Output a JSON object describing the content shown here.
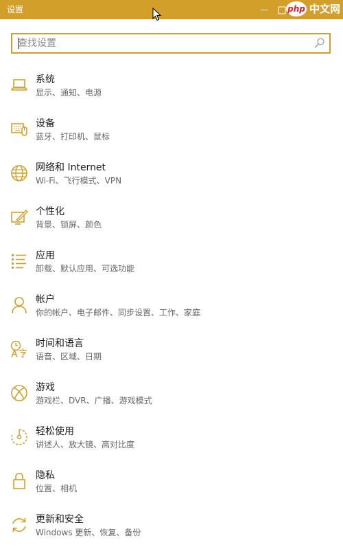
{
  "window": {
    "title": "设置",
    "accent_color": "#d29f2a"
  },
  "watermark": {
    "badge": "php",
    "text": "中文网"
  },
  "search": {
    "placeholder": "查找设置",
    "value": ""
  },
  "items": [
    {
      "title": "系统",
      "desc": "显示、通知、电源",
      "icon": "laptop-icon"
    },
    {
      "title": "设备",
      "desc": "蓝牙、打印机、鼠标",
      "icon": "devices-icon"
    },
    {
      "title": "网络和 Internet",
      "desc": "Wi-Fi、飞行模式、VPN",
      "icon": "globe-icon"
    },
    {
      "title": "个性化",
      "desc": "背景、锁屏、颜色",
      "icon": "personalization-icon"
    },
    {
      "title": "应用",
      "desc": "卸载、默认应用、可选功能",
      "icon": "apps-list-icon"
    },
    {
      "title": "帐户",
      "desc": "你的帐户、电子邮件、同步设置、工作、家庭",
      "icon": "person-icon"
    },
    {
      "title": "时间和语言",
      "desc": "语音、区域、日期",
      "icon": "time-language-icon"
    },
    {
      "title": "游戏",
      "desc": "游戏栏、DVR、广播、游戏模式",
      "icon": "xbox-icon"
    },
    {
      "title": "轻松使用",
      "desc": "讲述人、放大镜、高对比度",
      "icon": "ease-of-access-icon"
    },
    {
      "title": "隐私",
      "desc": "位置、相机",
      "icon": "lock-icon"
    },
    {
      "title": "更新和安全",
      "desc": "Windows 更新、恢复、备份",
      "icon": "sync-icon"
    }
  ]
}
